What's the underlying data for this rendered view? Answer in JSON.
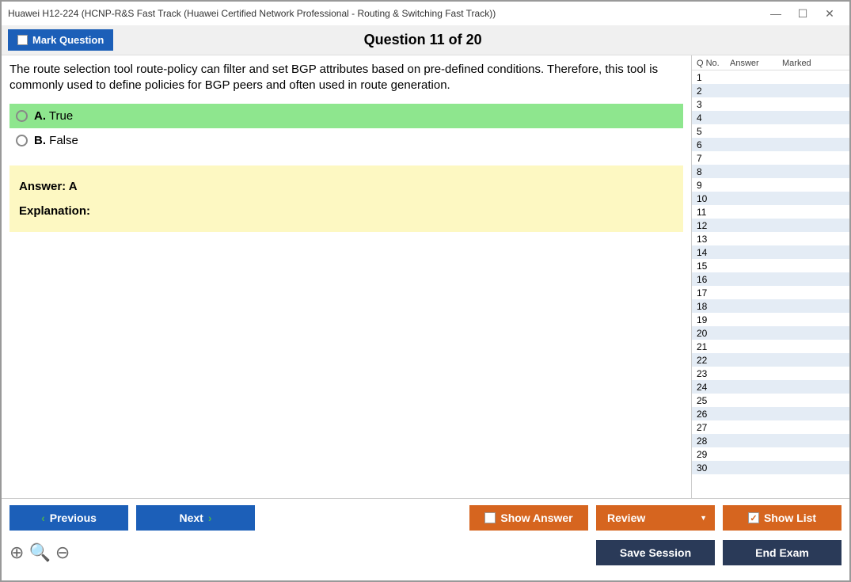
{
  "title": "Huawei H12-224 (HCNP-R&S Fast Track (Huawei Certified Network Professional - Routing & Switching Fast Track))",
  "toolbar": {
    "mark_label": "Mark Question",
    "question_title": "Question 11 of 20"
  },
  "question": {
    "text": "The route selection tool route-policy can filter and set BGP attributes based on pre-defined conditions. Therefore, this tool is commonly used to define policies for BGP peers and often used in route generation.",
    "options": [
      {
        "letter": "A.",
        "text": "True",
        "selected": true
      },
      {
        "letter": "B.",
        "text": "False",
        "selected": false
      }
    ],
    "answer_label": "Answer: A",
    "explanation_label": "Explanation:"
  },
  "sidebar": {
    "headers": {
      "qno": "Q No.",
      "answer": "Answer",
      "marked": "Marked"
    },
    "rows": [
      1,
      2,
      3,
      4,
      5,
      6,
      7,
      8,
      9,
      10,
      11,
      12,
      13,
      14,
      15,
      16,
      17,
      18,
      19,
      20,
      21,
      22,
      23,
      24,
      25,
      26,
      27,
      28,
      29,
      30
    ]
  },
  "buttons": {
    "previous": "Previous",
    "next": "Next",
    "show_answer": "Show Answer",
    "review": "Review",
    "show_list": "Show List",
    "save_session": "Save Session",
    "end_exam": "End Exam"
  }
}
